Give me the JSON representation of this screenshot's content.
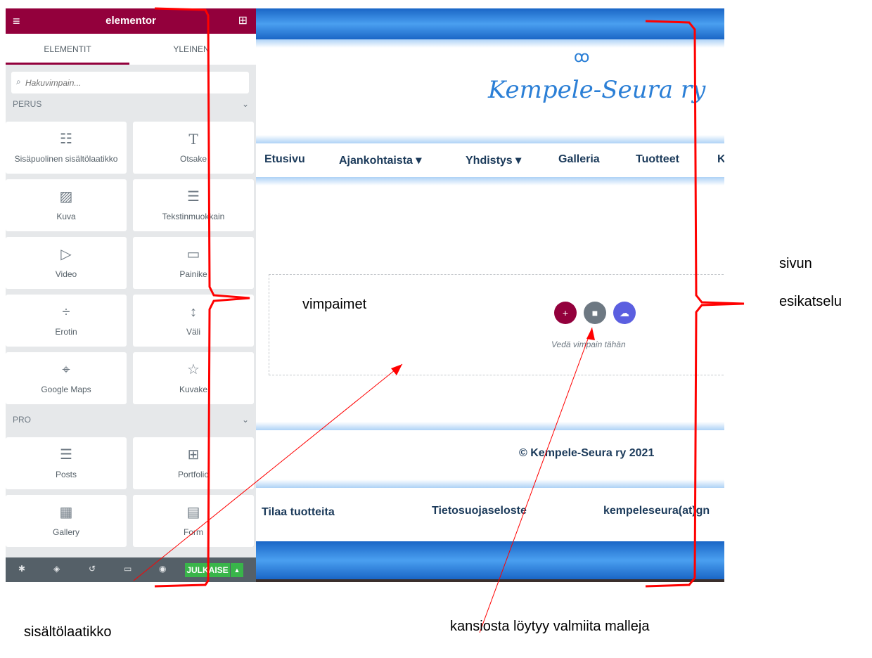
{
  "panel": {
    "brand": "elementor",
    "menu_icon": "hamburger-icon",
    "grid_icon": "grid-icon",
    "tabs": [
      {
        "label": "ELEMENTIT"
      },
      {
        "label": "YLEINEN"
      }
    ],
    "search": {
      "placeholder": "Hakuvimpain..."
    },
    "categories": [
      {
        "label": "PERUS"
      },
      {
        "label": "PRO"
      }
    ],
    "widgets": [
      {
        "label": "Sisäpuolinen sisältölaatikko",
        "icon": "inner-section-icon"
      },
      {
        "label": "Otsake",
        "icon": "heading-icon"
      },
      {
        "label": "Kuva",
        "icon": "image-icon"
      },
      {
        "label": "Tekstinmuokkain",
        "icon": "text-editor-icon"
      },
      {
        "label": "Video",
        "icon": "video-icon"
      },
      {
        "label": "Painike",
        "icon": "button-icon"
      },
      {
        "label": "Erotin",
        "icon": "divider-icon"
      },
      {
        "label": "Väli",
        "icon": "spacer-icon"
      },
      {
        "label": "Google Maps",
        "icon": "map-icon"
      },
      {
        "label": "Kuvake",
        "icon": "star-icon"
      },
      {
        "label": "Posts",
        "icon": "posts-icon"
      },
      {
        "label": "Portfolio",
        "icon": "portfolio-icon"
      },
      {
        "label": "Gallery",
        "icon": "gallery-icon"
      },
      {
        "label": "Form",
        "icon": "form-icon"
      }
    ],
    "footer": {
      "icons": [
        "settings-icon",
        "layers-icon",
        "history-icon",
        "responsive-icon",
        "eye-icon"
      ],
      "publish_label": "JULKAISE"
    }
  },
  "preview": {
    "site_title": "Kempele-Seura ry",
    "nav": [
      "Etusivu",
      "Ajankohtaista ▾",
      "Yhdistys ▾",
      "Galleria",
      "Tuotteet",
      "K"
    ],
    "drop_zone_text": "Vedä vimpain tähän",
    "drop_zone_buttons": [
      "add-section-icon",
      "template-folder-icon",
      "cloud-kit-icon"
    ],
    "copyright": "© Kempele-Seura ry 2021",
    "footer_links": [
      "Tilaa tuotteita",
      "Tietosuojaseloste",
      "kempeleseura(at)gn"
    ]
  },
  "annotations": {
    "widgets": "vimpaimet",
    "preview_line1": "sivun",
    "preview_line2": "esikatselu",
    "section": "sisältölaatikko",
    "templates": "kansiosta löytyy valmiita malleja"
  },
  "colors": {
    "brand": "#93003c",
    "publish": "#39b54a",
    "heading_blue": "#2b7fd6",
    "nav_text": "#1b3a5a",
    "annotation": "#ff0000"
  }
}
